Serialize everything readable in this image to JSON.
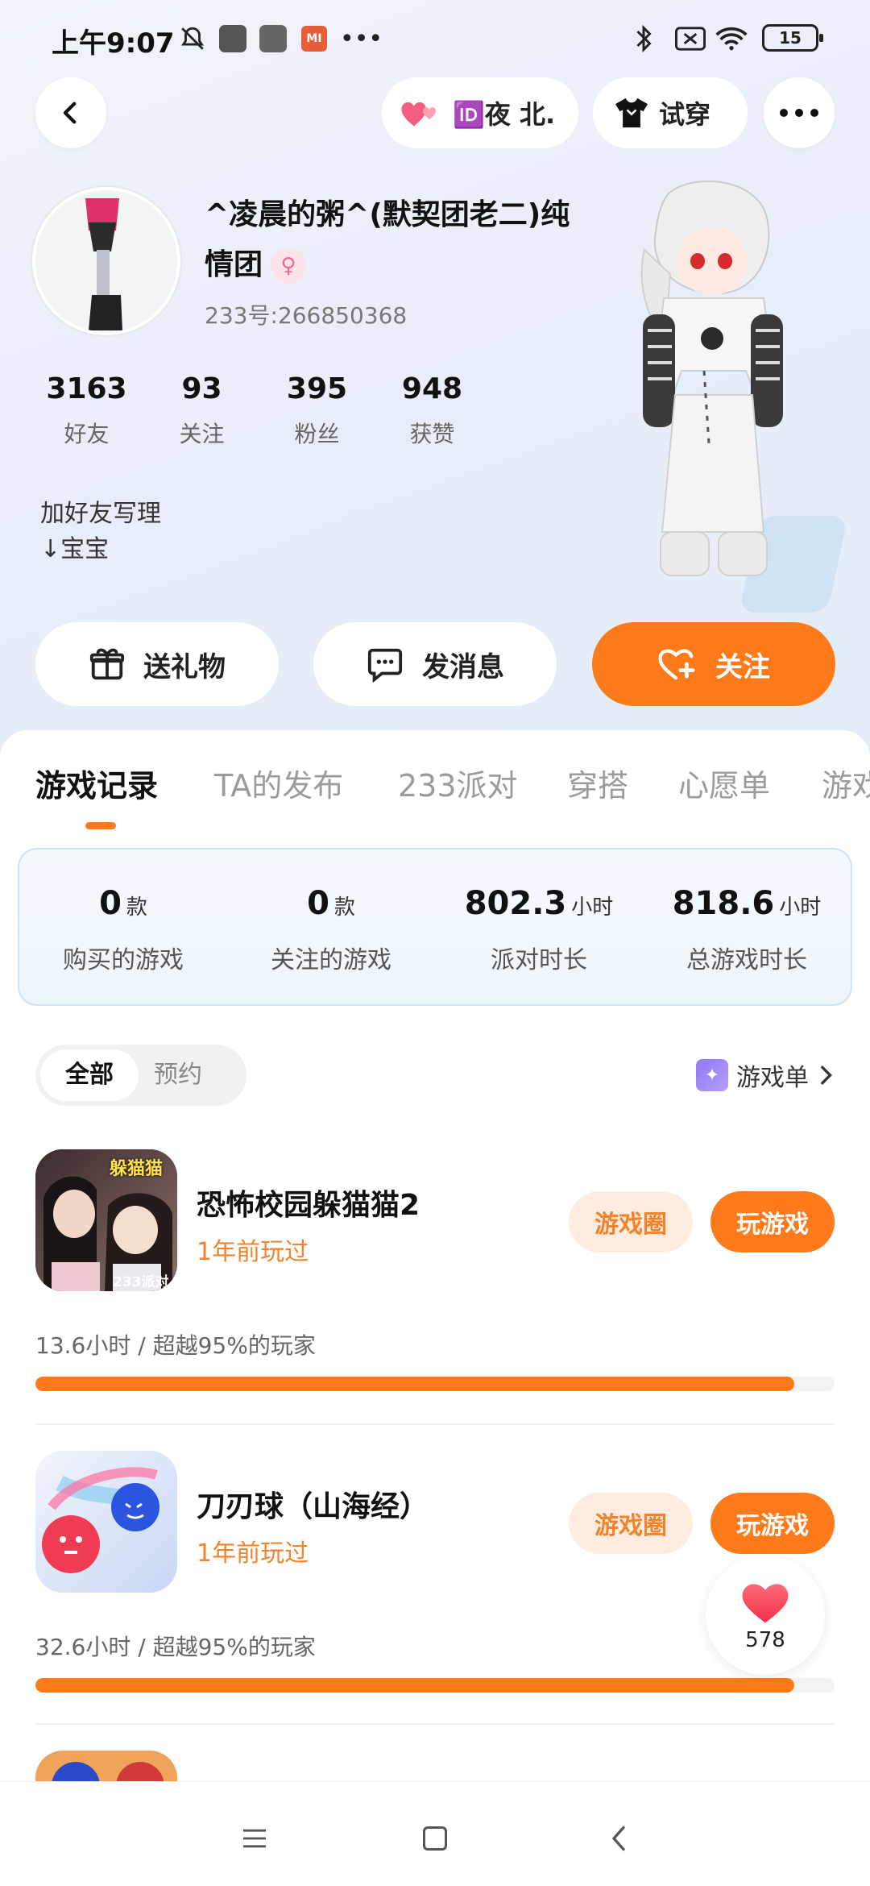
{
  "status_bar": {
    "time": "上午9:07",
    "mi_label": "MI",
    "more": "•••",
    "battery": "15"
  },
  "header": {
    "friend_tag": "🆔夜 北.",
    "try_on_label": "试穿"
  },
  "profile": {
    "nickname": "^凌晨的粥^(默契团老二)纯情团",
    "uid": "233号:266850368",
    "stats": [
      {
        "value": "3163",
        "label": "好友"
      },
      {
        "value": "93",
        "label": "关注"
      },
      {
        "value": "395",
        "label": "粉丝"
      },
      {
        "value": "948",
        "label": "获赞"
      }
    ],
    "bio": "加好友写理\n↓宝宝"
  },
  "actions": {
    "gift": "送礼物",
    "message": "发消息",
    "follow": "关注"
  },
  "tabs": [
    "游戏记录",
    "TA的发布",
    "233派对",
    "穿搭",
    "心愿单",
    "游戏"
  ],
  "summary": [
    {
      "value": "0",
      "unit": "款",
      "label": "购买的游戏"
    },
    {
      "value": "0",
      "unit": "款",
      "label": "关注的游戏"
    },
    {
      "value": "802.3",
      "unit": "小时",
      "label": "派对时长"
    },
    {
      "value": "818.6",
      "unit": "小时",
      "label": "总游戏时长"
    }
  ],
  "filter": {
    "all": "全部",
    "reserved": "预约",
    "gamelist": "游戏单"
  },
  "games": [
    {
      "name": "恐怖校园躲猫猫2",
      "played": "1年前玩过",
      "circle_label": "游戏圈",
      "play_label": "玩游戏",
      "stat": "13.6小时 / 超越95%的玩家",
      "progress": 0.95,
      "icon_text": "躲猫猫",
      "icon_sub": "233派对"
    },
    {
      "name": "刀刃球（山海经）",
      "played": "1年前玩过",
      "circle_label": "游戏圈",
      "play_label": "玩游戏",
      "stat": "32.6小时 / 超越95%的玩家",
      "progress": 0.95
    }
  ],
  "like": {
    "count": "578"
  },
  "colors": {
    "accent": "#ff7a1a",
    "played": "#f0842c"
  }
}
